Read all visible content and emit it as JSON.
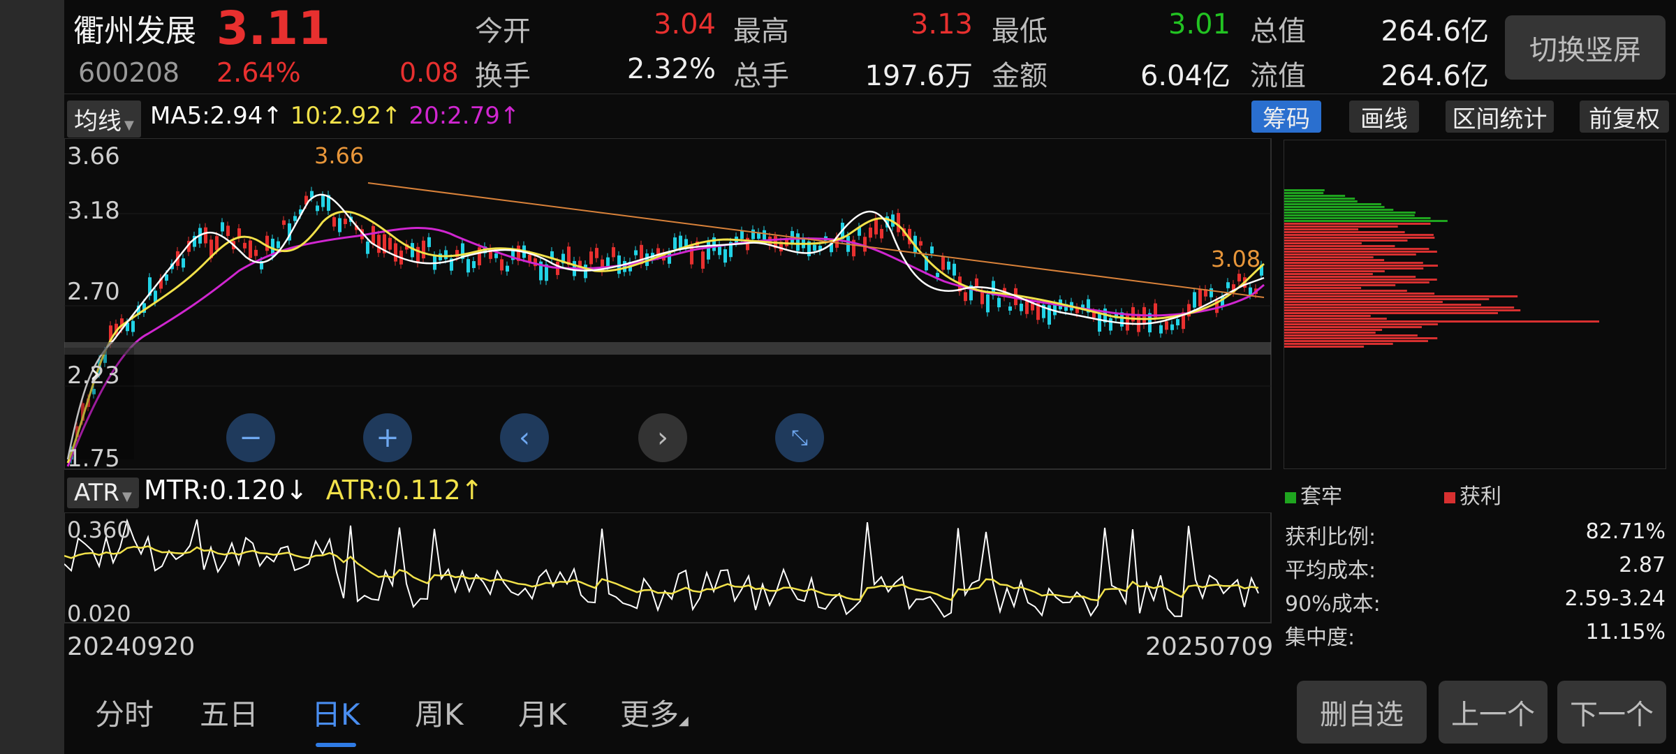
{
  "quote": {
    "name": "衢州发展",
    "price": "3.11",
    "code": "600208",
    "change_pct": "2.64%",
    "change": "0.08",
    "fields": [
      {
        "label": "今开",
        "value": "3.04",
        "color": "red"
      },
      {
        "label": "最高",
        "value": "3.13",
        "color": "red"
      },
      {
        "label": "最低",
        "value": "3.01",
        "color": "green"
      },
      {
        "label": "总值",
        "value": "264.6亿",
        "color": "white"
      },
      {
        "label": "换手",
        "value": "2.32%",
        "color": "white"
      },
      {
        "label": "总手",
        "value": "197.6万",
        "color": "white"
      },
      {
        "label": "金额",
        "value": "6.04亿",
        "color": "white"
      },
      {
        "label": "流值",
        "value": "264.6亿",
        "color": "white"
      }
    ],
    "switch_label": "切换竖屏"
  },
  "main_indicator": {
    "selector": "均线",
    "ma5": "MA5:2.94",
    "ma10": "10:2.92",
    "ma20": "20:2.79",
    "up_arrow": "↑",
    "colors": {
      "ma5": "#ffffff",
      "ma10": "#f2e24a",
      "ma20": "#d026d0"
    }
  },
  "toolbar": {
    "chips": "筹码",
    "draw": "画线",
    "range_stats": "区间统计",
    "adjust": "前复权"
  },
  "kline": {
    "y_ticks": [
      "3.66",
      "3.18",
      "2.70",
      "2.23",
      "1.75"
    ],
    "high_marker": "3.66",
    "last_marker": "3.08",
    "start_date": "20240920",
    "end_date": "20250709"
  },
  "sub_indicator": {
    "selector": "ATR",
    "mtr": "MTR:0.120",
    "mtr_arrow": "↓",
    "atr": "ATR:0.112",
    "atr_arrow": "↑",
    "y_ticks": [
      "0.360",
      "0.020"
    ]
  },
  "chips_panel": {
    "legend_trapped": "套牢",
    "legend_profit": "获利",
    "stats": [
      {
        "label": "获利比例:",
        "value": "82.71%"
      },
      {
        "label": "平均成本:",
        "value": "2.87"
      },
      {
        "label": "90%成本:",
        "value": "2.59-3.24"
      },
      {
        "label": "集中度:",
        "value": "11.15%"
      }
    ],
    "colors": {
      "trapped": "#1fa51f",
      "profit": "#d83030"
    }
  },
  "tabs": [
    "分时",
    "五日",
    "日K",
    "周K",
    "月K",
    "更多"
  ],
  "active_tab": "日K",
  "buttons": {
    "remove_watch": "删自选",
    "prev": "上一个",
    "next": "下一个"
  },
  "colors": {
    "up": "#e8302f",
    "down": "#22c322",
    "candle_down": "#22d3e6",
    "accent": "#2f7be5"
  }
}
